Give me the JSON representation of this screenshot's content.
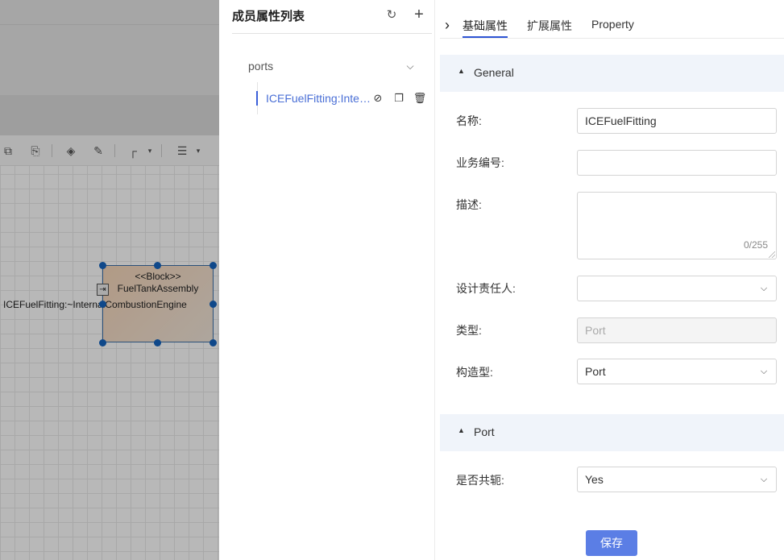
{
  "canvas": {
    "block_stereotype": "<<Block>>",
    "block_name": "FuelTankAssembly",
    "port_label": "ICEFuelFitting:~InternalCombustionEngine"
  },
  "member_panel": {
    "title": "成员属性列表",
    "group_label": "ports",
    "item_label": "ICEFuelFitting:InternalCombustionEngine"
  },
  "property_panel": {
    "tabs": [
      "基础属性",
      "扩展属性",
      "Property"
    ],
    "active_tab": "基础属性",
    "general_section": "General",
    "port_section": "Port",
    "fields": {
      "name_label": "名称:",
      "name_value": "ICEFuelFitting",
      "biz_code_label": "业务编号:",
      "biz_code_value": "",
      "desc_label": "描述:",
      "desc_count": "0/255",
      "owner_label": "设计责任人:",
      "owner_value": "",
      "type_label": "类型:",
      "type_value": "Port",
      "stereotype_label": "构造型:",
      "stereotype_value": "Port",
      "conjugated_label": "是否共轭:",
      "conjugated_value": "Yes"
    },
    "save_label": "保存"
  },
  "colors": {
    "accent": "#2f55d4",
    "link": "#4a6fd6",
    "save_button": "#5b7ee5",
    "section_bg": "#f0f4fa",
    "handle": "#1565c0"
  }
}
